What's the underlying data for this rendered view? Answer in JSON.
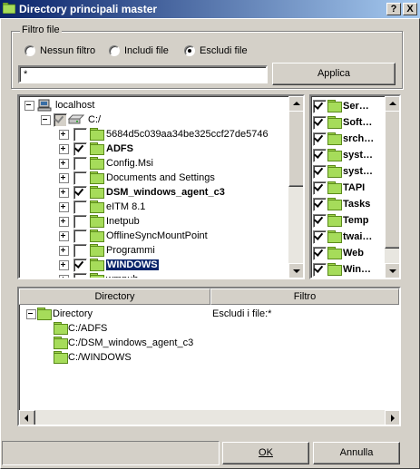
{
  "window": {
    "title": "Directory principali master",
    "help_label": "?",
    "close_label": "X"
  },
  "filter": {
    "group_label": "Filtro file",
    "options": [
      {
        "label": "Nessun filtro",
        "selected": false
      },
      {
        "label": "Includi file",
        "selected": false
      },
      {
        "label": "Escludi file",
        "selected": true
      }
    ],
    "pattern_value": "*",
    "apply_label": "Applica"
  },
  "tree": {
    "root_label": "localhost",
    "drive_label": "C:/",
    "items": [
      {
        "label": "5684d5c039aa34be325ccf27de5746",
        "checked": false,
        "bold": false,
        "selected": false
      },
      {
        "label": "ADFS",
        "checked": true,
        "bold": true,
        "selected": false
      },
      {
        "label": "Config.Msi",
        "checked": false,
        "bold": false,
        "selected": false
      },
      {
        "label": "Documents and Settings",
        "checked": false,
        "bold": false,
        "selected": false
      },
      {
        "label": "DSM_windows_agent_c3",
        "checked": true,
        "bold": true,
        "selected": false
      },
      {
        "label": "eITM 8.1",
        "checked": false,
        "bold": false,
        "selected": false
      },
      {
        "label": "Inetpub",
        "checked": false,
        "bold": false,
        "selected": false
      },
      {
        "label": "OfflineSyncMountPoint",
        "checked": false,
        "bold": false,
        "selected": false
      },
      {
        "label": "Programmi",
        "checked": false,
        "bold": false,
        "selected": false
      },
      {
        "label": "WINDOWS",
        "checked": true,
        "bold": true,
        "selected": true
      },
      {
        "label": "wmpub",
        "checked": false,
        "bold": false,
        "selected": false
      }
    ]
  },
  "subfolders": {
    "items": [
      "Ser…",
      "Soft…",
      "srch…",
      "syst…",
      "syst…",
      "TAPI",
      "Tasks",
      "Temp",
      "twai…",
      "Web",
      "Win…"
    ]
  },
  "results": {
    "col_directory": "Directory",
    "col_filter": "Filtro",
    "root_label": "Directory",
    "root_filter": "Escludi i file:*",
    "items": [
      "C:/ADFS",
      "C:/DSM_windows_agent_c3",
      "C:/WINDOWS"
    ]
  },
  "footer": {
    "ok_label": "OK",
    "cancel_label": "Annulla"
  },
  "colors": {
    "titlebar_start": "#0a246a",
    "titlebar_end": "#a6caf0",
    "folder": "#a6dc5a",
    "face": "#d4d0c8"
  }
}
